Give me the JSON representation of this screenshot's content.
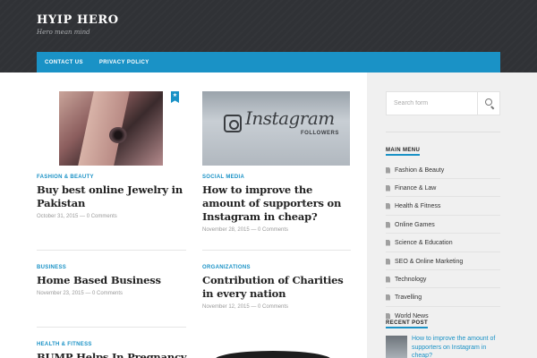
{
  "site": {
    "title": "HYIP HERO",
    "description": "Hero mean mind"
  },
  "nav": {
    "items": [
      "CONTACT US",
      "PRIVACY POLICY"
    ]
  },
  "posts": [
    {
      "category": "FASHION & BEAUTY",
      "title": "Buy best online Jewelry in Pakistan",
      "date": "October 31, 2015",
      "comments": "0 Comments",
      "featured": true
    },
    {
      "category": "SOCIAL MEDIA",
      "title": "How to improve the amount of supporters on Instagram in cheap?",
      "date": "November 28, 2015",
      "comments": "0 Comments",
      "thumb_text": "Instagram",
      "thumb_sub": "FOLLOWERS"
    },
    {
      "category": "BUSINESS",
      "title": "Home Based Business",
      "date": "November 23, 2015",
      "comments": "0 Comments"
    },
    {
      "category": "ORGANIZATIONS",
      "title": "Contribution of Charities in every nation",
      "date": "November 12, 2015",
      "comments": "0 Comments"
    },
    {
      "category": "HEALTH & FITNESS",
      "title": "BUMP Helps In Pregnancy"
    }
  ],
  "meta_sep": "—",
  "featured_icon": "★",
  "sidebar": {
    "search_placeholder": "Search form",
    "main_menu_title": "MAIN MENU",
    "menu": [
      "Fashion & Beauty",
      "Finance & Law",
      "Health & Fitness",
      "Online Games",
      "Science & Education",
      "SEO & Online Marketing",
      "Technology",
      "Travelling",
      "World News"
    ],
    "recent_title": "RECENT POST",
    "recent_post": "How to improve the amount of supporters on Instagram in cheap?"
  },
  "colors": {
    "header_bg": "#303236",
    "accent": "#1a92c6",
    "sidebar_bg": "#f0f0f0"
  }
}
